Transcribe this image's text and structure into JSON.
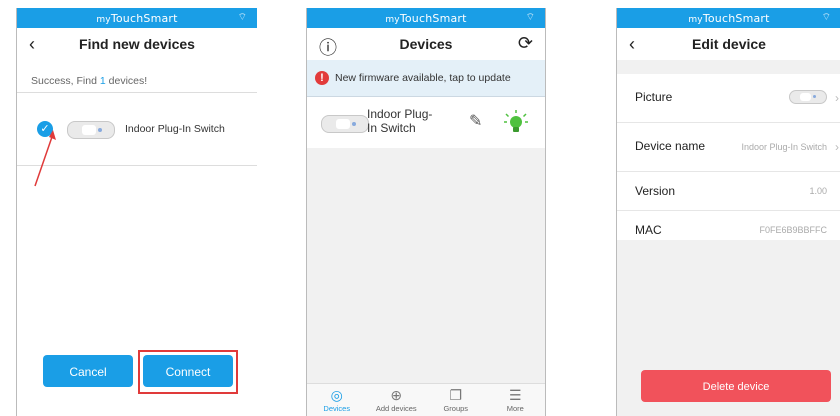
{
  "app": {
    "brand_prefix": "my",
    "brand_name": "TouchSmart",
    "status_icon": "wifi-icon"
  },
  "find": {
    "title": "Find new devices",
    "back": "‹",
    "success_prefix": "Success, Find ",
    "success_count": "1",
    "success_suffix": " devices!",
    "device_name": "Indoor Plug-In Switch",
    "cancel_label": "Cancel",
    "connect_label": "Connect"
  },
  "devices": {
    "title": "Devices",
    "info_icon": "ⓘ",
    "refresh_icon": "⟳",
    "banner_text": "New firmware available, tap to update",
    "device_name_line1": "Indoor Plug-",
    "device_name_line2": "In Switch",
    "tabs": [
      {
        "label": "Devices",
        "icon": "◎"
      },
      {
        "label": "Add devices",
        "icon": "⊕"
      },
      {
        "label": "Groups",
        "icon": "❐"
      },
      {
        "label": "More",
        "icon": "☰"
      }
    ]
  },
  "edit": {
    "title": "Edit device",
    "back": "‹",
    "rows": {
      "picture_label": "Picture",
      "name_label": "Device name",
      "name_value": "Indoor Plug-In Switch",
      "version_label": "Version",
      "version_value": "1.00",
      "mac_label": "MAC",
      "mac_value": "F0FE6B9BBFFC"
    },
    "delete_label": "Delete device"
  },
  "colors": {
    "accent": "#1a9ee6",
    "danger": "#f1525b",
    "highlight_frame": "#e03a3a",
    "bulb": "#4fc13f"
  }
}
